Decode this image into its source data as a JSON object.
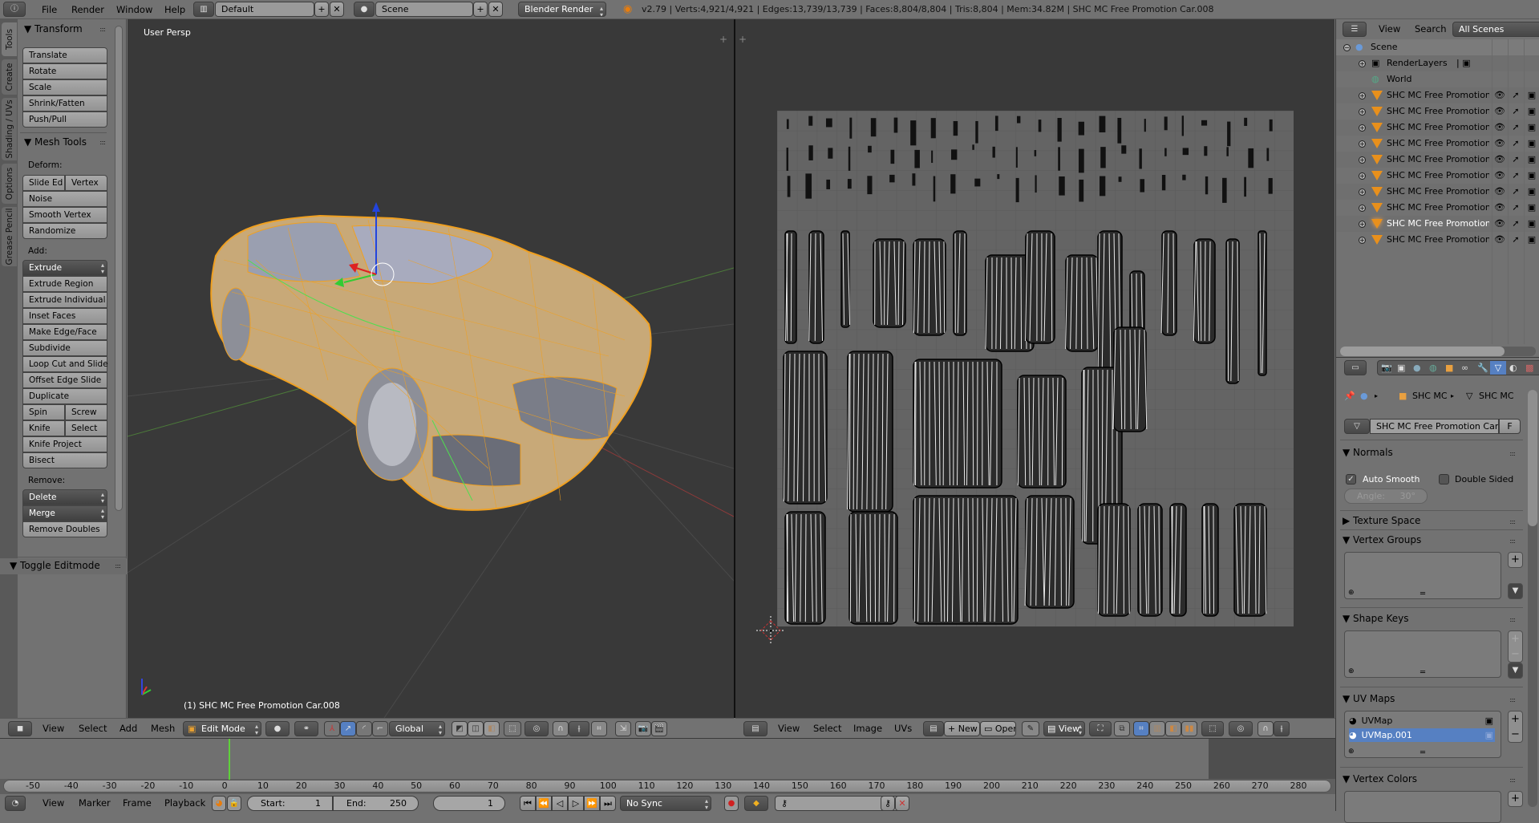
{
  "topbar": {
    "menus": [
      "File",
      "Render",
      "Window",
      "Help"
    ],
    "screen_layout": "Default",
    "scene": "Scene",
    "render_engine": "Blender Render",
    "stats": "v2.79 | Verts:4,921/4,921 | Edges:13,739/13,739 | Faces:8,804/8,804 | Tris:8,804 | Mem:34.82M | SHC MC Free Promotion Car.008"
  },
  "tool_tabs": [
    "Tools",
    "Create",
    "Shading / UVs",
    "Options",
    "Grease Pencil"
  ],
  "toolshelf": {
    "transform_title": "Transform",
    "transform_buttons": [
      "Translate",
      "Rotate",
      "Scale",
      "Shrink/Fatten",
      "Push/Pull"
    ],
    "mesh_tools_title": "Mesh Tools",
    "deform_label": "Deform:",
    "deform_row": [
      "Slide Ed",
      "Vertex"
    ],
    "deform_buttons": [
      "Noise",
      "Smooth Vertex",
      "Randomize"
    ],
    "add_label": "Add:",
    "extrude_menu": "Extrude",
    "add_buttons": [
      "Extrude Region",
      "Extrude Individual",
      "Inset Faces",
      "Make Edge/Face",
      "Subdivide",
      "Loop Cut and Slide",
      "Offset Edge Slide",
      "Duplicate"
    ],
    "spin_row": [
      "Spin",
      "Screw"
    ],
    "knife_row": [
      "Knife",
      "Select"
    ],
    "add_buttons2": [
      "Knife Project",
      "Bisect"
    ],
    "remove_label": "Remove:",
    "delete_menu": "Delete",
    "merge_menu": "Merge",
    "remove_doubles": "Remove Doubles",
    "toggle_editmode": "Toggle Editmode"
  },
  "viewport3d": {
    "view_label": "User Persp",
    "object_label": "(1) SHC MC Free Promotion Car.008",
    "header_menus": [
      "View",
      "Select",
      "Add",
      "Mesh"
    ],
    "mode": "Edit Mode",
    "orientation": "Global"
  },
  "uv_editor": {
    "header_menus": [
      "View",
      "Select",
      "Image",
      "UVs"
    ],
    "new_label": "New",
    "open_label": "Open",
    "view_mode": "View"
  },
  "outliner": {
    "menus": [
      "View",
      "Search"
    ],
    "filter": "All Scenes",
    "scene": "Scene",
    "render_layers": "RenderLayers",
    "world": "World",
    "objects": [
      "SHC MC Free Promotion Ca",
      "SHC MC Free Promotion Ca",
      "SHC MC Free Promotion Ca",
      "SHC MC Free Promotion Ca",
      "SHC MC Free Promotion Ca",
      "SHC MC Free Promotion Ca",
      "SHC MC Free Promotion Ca",
      "SHC MC Free Promotion Ca",
      "SHC MC Free Promotion Ca",
      "SHC MC Free Promotion Ca"
    ],
    "active_index": 8
  },
  "properties": {
    "breadcrumb_object": "SHC MC",
    "breadcrumb_mesh": "SHC MC",
    "mesh_name": "SHC MC Free Promotion Car....",
    "fake_user": "F",
    "normals_title": "Normals",
    "auto_smooth": "Auto Smooth",
    "auto_smooth_checked": true,
    "double_sided": "Double Sided",
    "double_sided_checked": false,
    "angle_label": "Angle:",
    "angle_value": "30°",
    "texture_space": "Texture Space",
    "vertex_groups": "Vertex Groups",
    "shape_keys": "Shape Keys",
    "uv_maps": "UV Maps",
    "uv_map_items": [
      "UVMap",
      "UVMap.001"
    ],
    "uv_active_index": 1,
    "vertex_colors": "Vertex Colors"
  },
  "timeline": {
    "ticks": [
      "-50",
      "-40",
      "-30",
      "-20",
      "-10",
      "0",
      "10",
      "20",
      "30",
      "40",
      "50",
      "60",
      "70",
      "80",
      "90",
      "100",
      "110",
      "120",
      "130",
      "140",
      "150",
      "160",
      "170",
      "180",
      "190",
      "200",
      "210",
      "220",
      "230",
      "240",
      "250",
      "260",
      "270",
      "280"
    ],
    "current_frame_marker": "0",
    "menus": [
      "View",
      "Marker",
      "Frame",
      "Playback"
    ],
    "start_label": "Start:",
    "start_value": "1",
    "end_label": "End:",
    "end_value": "250",
    "current_frame": "1",
    "sync": "No Sync"
  },
  "colors": {
    "selection_orange": "#f0a020",
    "active_blue": "#5680c2",
    "viewport_bg": "#393939",
    "panel_bg": "#727272"
  }
}
